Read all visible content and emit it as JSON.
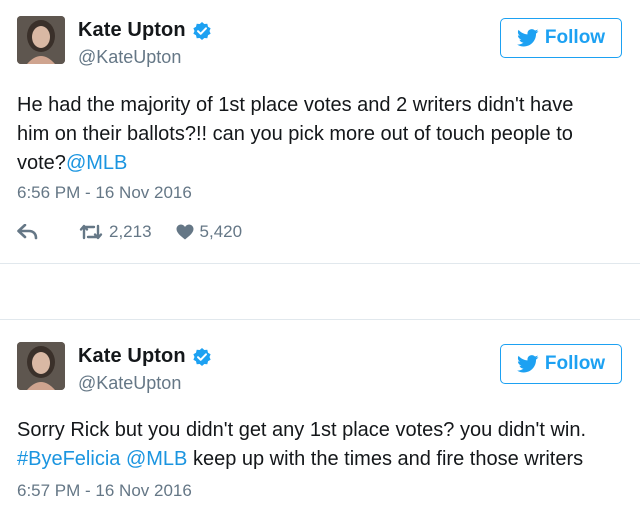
{
  "tweets": [
    {
      "name": "Kate Upton",
      "handle": "@KateUpton",
      "follow_label": "Follow",
      "text_lines": [
        "He had the majority of 1st place votes and 2 writers didn't have",
        "him on their ballots?!! can you pick more out of touch people to",
        "vote?"
      ],
      "mention": "@MLB",
      "timestamp": "6:56 PM - 16 Nov 2016",
      "retweets": "2,213",
      "likes": "5,420"
    },
    {
      "name": "Kate Upton",
      "handle": "@KateUpton",
      "follow_label": "Follow",
      "text_line1": "Sorry Rick but you didn't get any 1st place votes? you didn't win.",
      "hashtag": "#ByeFelicia",
      "mention": "@MLB",
      "text_rest": " keep up with the times and fire those writers",
      "timestamp": "6:57 PM - 16 Nov 2016"
    }
  ],
  "colors": {
    "accent": "#1da1f2",
    "link": "#1b95e0",
    "muted": "#657786",
    "divider": "#e1e8ed"
  },
  "icons": [
    "verified-badge-icon",
    "twitter-bird-icon",
    "reply-icon",
    "retweet-icon",
    "heart-icon"
  ]
}
